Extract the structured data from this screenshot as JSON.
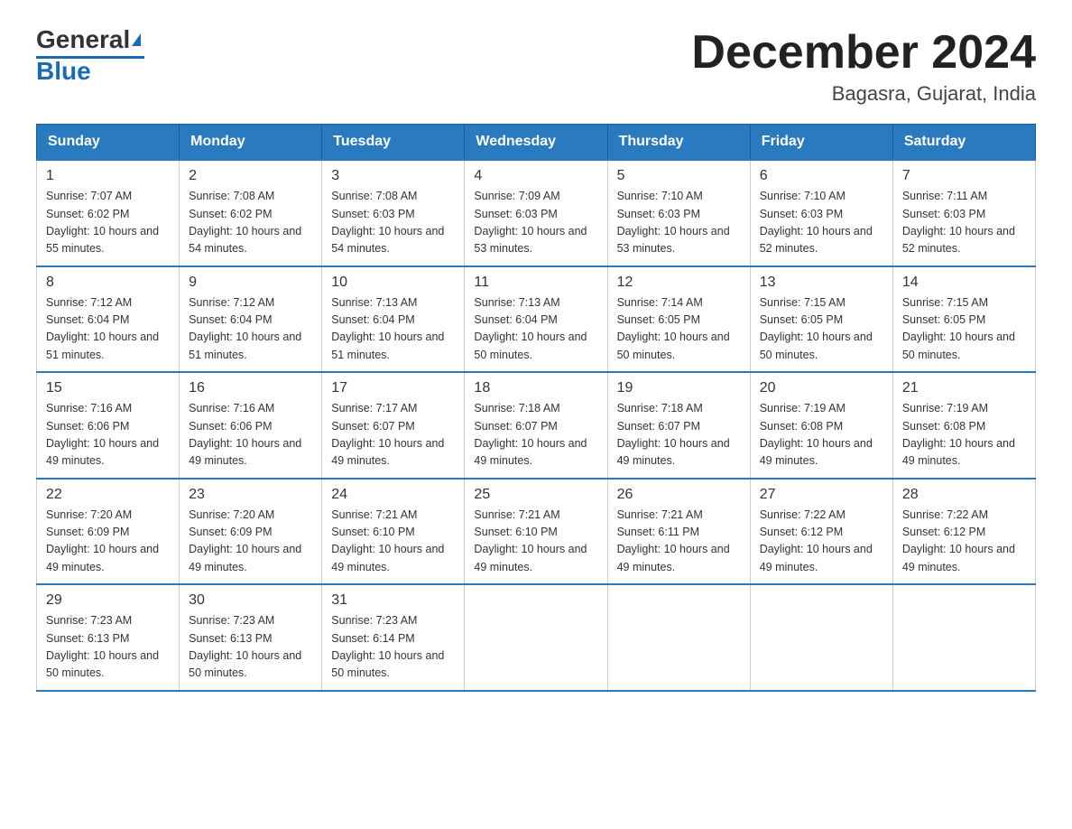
{
  "logo": {
    "text_general": "General",
    "text_blue": "Blue"
  },
  "title": "December 2024",
  "location": "Bagasra, Gujarat, India",
  "days_of_week": [
    "Sunday",
    "Monday",
    "Tuesday",
    "Wednesday",
    "Thursday",
    "Friday",
    "Saturday"
  ],
  "weeks": [
    [
      {
        "day": "1",
        "sunrise": "7:07 AM",
        "sunset": "6:02 PM",
        "daylight": "10 hours and 55 minutes."
      },
      {
        "day": "2",
        "sunrise": "7:08 AM",
        "sunset": "6:02 PM",
        "daylight": "10 hours and 54 minutes."
      },
      {
        "day": "3",
        "sunrise": "7:08 AM",
        "sunset": "6:03 PM",
        "daylight": "10 hours and 54 minutes."
      },
      {
        "day": "4",
        "sunrise": "7:09 AM",
        "sunset": "6:03 PM",
        "daylight": "10 hours and 53 minutes."
      },
      {
        "day": "5",
        "sunrise": "7:10 AM",
        "sunset": "6:03 PM",
        "daylight": "10 hours and 53 minutes."
      },
      {
        "day": "6",
        "sunrise": "7:10 AM",
        "sunset": "6:03 PM",
        "daylight": "10 hours and 52 minutes."
      },
      {
        "day": "7",
        "sunrise": "7:11 AM",
        "sunset": "6:03 PM",
        "daylight": "10 hours and 52 minutes."
      }
    ],
    [
      {
        "day": "8",
        "sunrise": "7:12 AM",
        "sunset": "6:04 PM",
        "daylight": "10 hours and 51 minutes."
      },
      {
        "day": "9",
        "sunrise": "7:12 AM",
        "sunset": "6:04 PM",
        "daylight": "10 hours and 51 minutes."
      },
      {
        "day": "10",
        "sunrise": "7:13 AM",
        "sunset": "6:04 PM",
        "daylight": "10 hours and 51 minutes."
      },
      {
        "day": "11",
        "sunrise": "7:13 AM",
        "sunset": "6:04 PM",
        "daylight": "10 hours and 50 minutes."
      },
      {
        "day": "12",
        "sunrise": "7:14 AM",
        "sunset": "6:05 PM",
        "daylight": "10 hours and 50 minutes."
      },
      {
        "day": "13",
        "sunrise": "7:15 AM",
        "sunset": "6:05 PM",
        "daylight": "10 hours and 50 minutes."
      },
      {
        "day": "14",
        "sunrise": "7:15 AM",
        "sunset": "6:05 PM",
        "daylight": "10 hours and 50 minutes."
      }
    ],
    [
      {
        "day": "15",
        "sunrise": "7:16 AM",
        "sunset": "6:06 PM",
        "daylight": "10 hours and 49 minutes."
      },
      {
        "day": "16",
        "sunrise": "7:16 AM",
        "sunset": "6:06 PM",
        "daylight": "10 hours and 49 minutes."
      },
      {
        "day": "17",
        "sunrise": "7:17 AM",
        "sunset": "6:07 PM",
        "daylight": "10 hours and 49 minutes."
      },
      {
        "day": "18",
        "sunrise": "7:18 AM",
        "sunset": "6:07 PM",
        "daylight": "10 hours and 49 minutes."
      },
      {
        "day": "19",
        "sunrise": "7:18 AM",
        "sunset": "6:07 PM",
        "daylight": "10 hours and 49 minutes."
      },
      {
        "day": "20",
        "sunrise": "7:19 AM",
        "sunset": "6:08 PM",
        "daylight": "10 hours and 49 minutes."
      },
      {
        "day": "21",
        "sunrise": "7:19 AM",
        "sunset": "6:08 PM",
        "daylight": "10 hours and 49 minutes."
      }
    ],
    [
      {
        "day": "22",
        "sunrise": "7:20 AM",
        "sunset": "6:09 PM",
        "daylight": "10 hours and 49 minutes."
      },
      {
        "day": "23",
        "sunrise": "7:20 AM",
        "sunset": "6:09 PM",
        "daylight": "10 hours and 49 minutes."
      },
      {
        "day": "24",
        "sunrise": "7:21 AM",
        "sunset": "6:10 PM",
        "daylight": "10 hours and 49 minutes."
      },
      {
        "day": "25",
        "sunrise": "7:21 AM",
        "sunset": "6:10 PM",
        "daylight": "10 hours and 49 minutes."
      },
      {
        "day": "26",
        "sunrise": "7:21 AM",
        "sunset": "6:11 PM",
        "daylight": "10 hours and 49 minutes."
      },
      {
        "day": "27",
        "sunrise": "7:22 AM",
        "sunset": "6:12 PM",
        "daylight": "10 hours and 49 minutes."
      },
      {
        "day": "28",
        "sunrise": "7:22 AM",
        "sunset": "6:12 PM",
        "daylight": "10 hours and 49 minutes."
      }
    ],
    [
      {
        "day": "29",
        "sunrise": "7:23 AM",
        "sunset": "6:13 PM",
        "daylight": "10 hours and 50 minutes."
      },
      {
        "day": "30",
        "sunrise": "7:23 AM",
        "sunset": "6:13 PM",
        "daylight": "10 hours and 50 minutes."
      },
      {
        "day": "31",
        "sunrise": "7:23 AM",
        "sunset": "6:14 PM",
        "daylight": "10 hours and 50 minutes."
      },
      null,
      null,
      null,
      null
    ]
  ]
}
